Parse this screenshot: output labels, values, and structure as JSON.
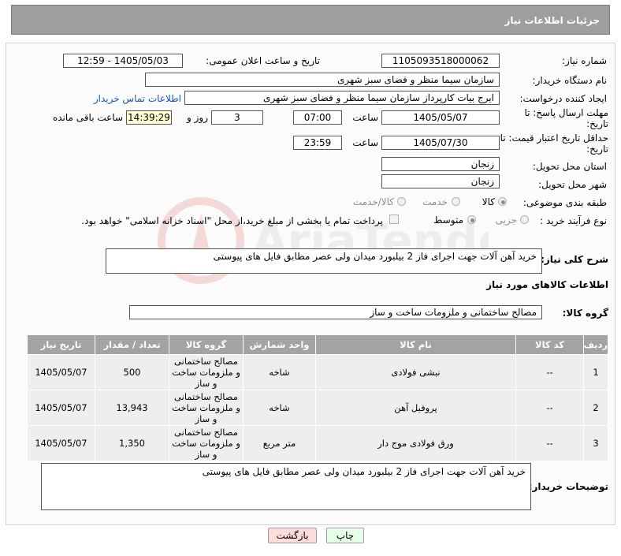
{
  "header": {
    "title": "جزئیات اطلاعات نیاز"
  },
  "form": {
    "need_number": {
      "label": "شماره نیاز:",
      "value": "1105093518000062"
    },
    "announce_datetime": {
      "label": "تاریخ و ساعت اعلان عمومی:",
      "value": "1405/05/03 - 12:59"
    },
    "buyer_org": {
      "label": "نام دستگاه خریدار:",
      "value": "سازمان سیما منظر و فضای سبز شهری"
    },
    "requester": {
      "label": "ایجاد کننده درخواست:",
      "value": "ایرج بیات کارپرداز سازمان سیما منظر و فضای سبز شهری",
      "contact_link": "اطلاعات تماس خریدار"
    },
    "reply_deadline": {
      "label": "مهلت ارسال پاسخ: تا تاریخ:",
      "date": "1405/05/07",
      "time_label": "ساعت",
      "time": "07:00",
      "days": "3",
      "days_label": "روز و",
      "remaining_time": "14:39:29",
      "remaining_label": "ساعت باقی مانده"
    },
    "price_validity": {
      "label": "حداقل تاریخ اعتبار قیمت: تا تاریخ:",
      "date": "1405/07/30",
      "time_label": "ساعت",
      "time": "23:59"
    },
    "delivery_province": {
      "label": "استان محل تحویل:",
      "value": "زنجان"
    },
    "delivery_city": {
      "label": "شهر محل تحویل:",
      "value": "زنجان"
    },
    "category": {
      "label": "طبقه بندی موضوعی:",
      "options": [
        "کالا",
        "خدمت",
        "کالا/خدمت"
      ],
      "selected": "کالا"
    },
    "purchase_type": {
      "label": "نوع فرآیند خرید :",
      "options": [
        "جزیی",
        "متوسط"
      ],
      "selected": "متوسط",
      "treasury_note": "پرداخت تمام یا بخشی از مبلغ خرید،از محل \"اسناد خزانه اسلامی\" خواهد بود."
    }
  },
  "description": {
    "label": "شرح کلی نیاز:",
    "value": "خرید آهن آلات جهت اجرای فاز 2 بیلبورد میدان ولی عصر مطابق فایل های پیوستی"
  },
  "goods_info": {
    "title": "اطلاعات کالاهای مورد نیاز"
  },
  "goods_group": {
    "label": "گروه کالا:",
    "value": "مصالح ساختمانی و ملزومات ساخت و ساز"
  },
  "table": {
    "headers": [
      "ردیف",
      "کد کالا",
      "نام کالا",
      "واحد شمارش",
      "گروه کالا",
      "تعداد / مقدار",
      "تاریخ نیاز"
    ],
    "rows": [
      {
        "row": "1",
        "code": "--",
        "name": "نبشی فولادی",
        "unit": "شاخه",
        "group": "مصالح ساختمانی و ملزومات ساخت و ساز",
        "qty": "500",
        "date": "1405/05/07"
      },
      {
        "row": "2",
        "code": "--",
        "name": "پروفیل آهن",
        "unit": "شاخه",
        "group": "مصالح ساختمانی و ملزومات ساخت و ساز",
        "qty": "13,943",
        "date": "1405/05/07"
      },
      {
        "row": "3",
        "code": "--",
        "name": "ورق فولادی موج دار",
        "unit": "متر مربع",
        "group": "مصالح ساختمانی و ملزومات ساخت و ساز",
        "qty": "1,350",
        "date": "1405/05/07"
      }
    ]
  },
  "buyer_notes": {
    "label": "توضیحات خریدار:",
    "value": "خرید آهن آلات جهت اجرای فاز 2 بیلبورد میدان ولی عصر مطابق فایل های پیوستی"
  },
  "buttons": {
    "print": "چاپ",
    "back": "بازگشت"
  },
  "watermark": {
    "text": "AriaTender.neT"
  },
  "colors": {
    "header_bg": "#9e9e9e",
    "table_header_bg": "#a3a3a3",
    "link": "#1a56b5",
    "back_button_bg": "#ffdcdc",
    "print_button_bg": "#e6ffe6"
  }
}
